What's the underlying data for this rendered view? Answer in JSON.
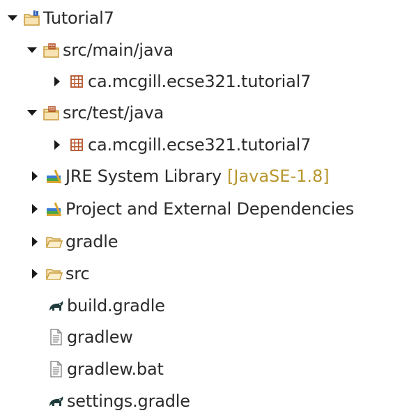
{
  "tree": {
    "project": {
      "label": "Tutorial7"
    },
    "src_main": {
      "label": "src/main/java"
    },
    "main_pkg": {
      "label": "ca.mcgill.ecse321.tutorial7"
    },
    "src_test": {
      "label": "src/test/java"
    },
    "test_pkg": {
      "label": "ca.mcgill.ecse321.tutorial7"
    },
    "jre": {
      "label": "JRE System Library",
      "decoration": "[JavaSE-1.8]"
    },
    "deps": {
      "label": "Project and External Dependencies"
    },
    "gradle_folder": {
      "label": "gradle"
    },
    "src_folder": {
      "label": "src"
    },
    "build_gradle": {
      "label": "build.gradle"
    },
    "gradlew": {
      "label": "gradlew"
    },
    "gradlew_bat": {
      "label": "gradlew.bat"
    },
    "settings_gradle": {
      "label": "settings.gradle"
    }
  },
  "colors": {
    "arrow": "#1a1a1a",
    "folder_fill": "#f7e3b3",
    "folder_stroke": "#c99a3a",
    "package": "#b5532a",
    "decoration": "#b8972f",
    "gradle_icon": "#1f3b3b"
  },
  "icons": {
    "expanded": "chevron-down-icon",
    "collapsed": "chevron-right-icon",
    "project": "java-project-icon",
    "source_folder": "source-folder-icon",
    "package": "package-icon",
    "library": "library-icon",
    "folder": "folder-icon",
    "gradle": "gradle-elephant-icon",
    "file": "text-file-icon"
  }
}
